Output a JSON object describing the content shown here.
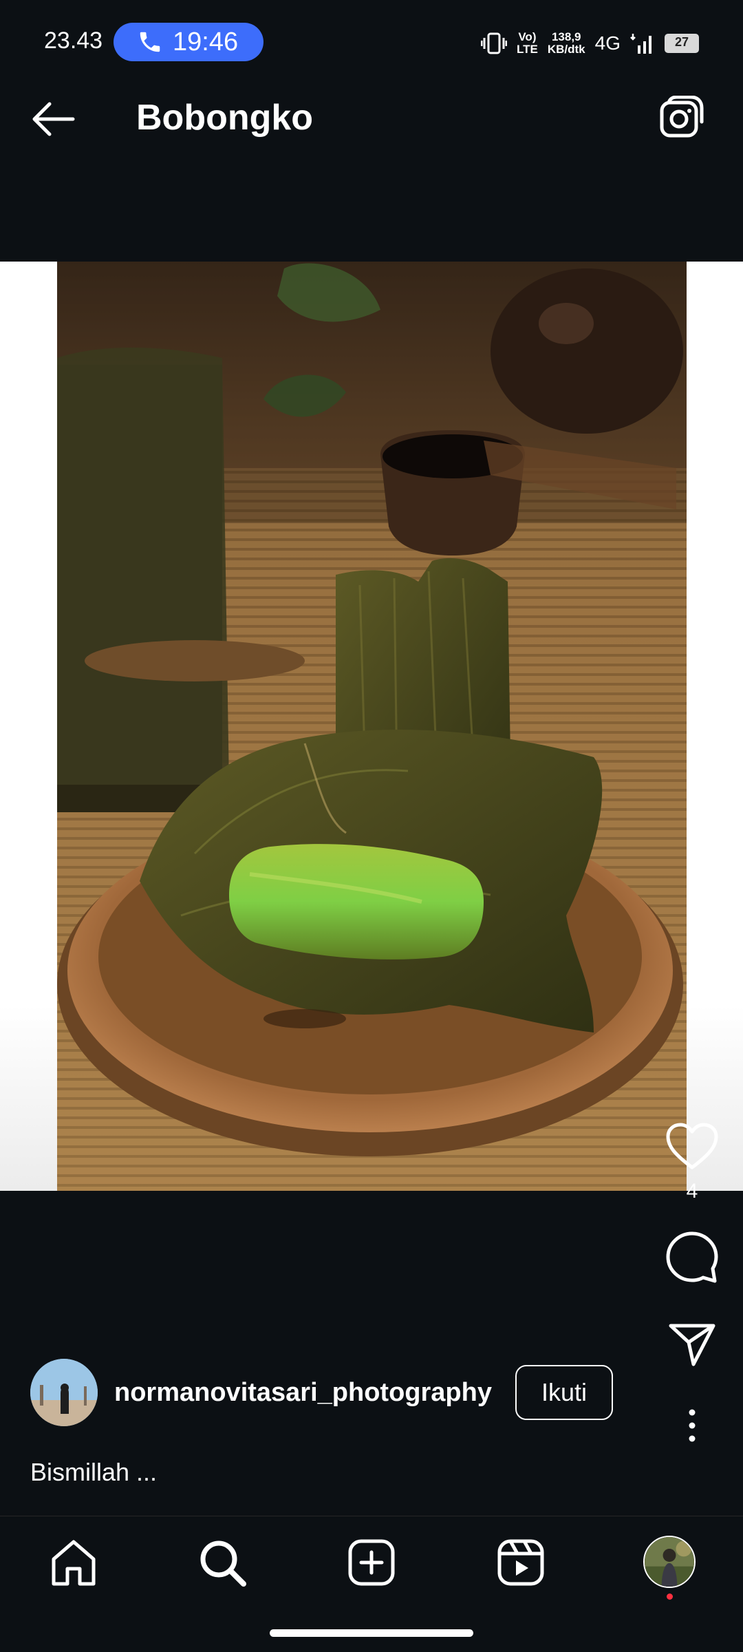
{
  "status_bar": {
    "time": "23.43",
    "call_time": "19:46",
    "network_speed_value": "138,9",
    "network_speed_unit": "KB/dtk",
    "volte_top": "Vo)",
    "volte_bottom": "LTE",
    "network_type": "4G",
    "battery_level": "27"
  },
  "header": {
    "title": "Bobongko"
  },
  "post": {
    "like_count": "4",
    "author": "normanovitasari_photography",
    "follow_label": "Ikuti",
    "caption": "Bismillah ..."
  },
  "icons": {
    "back": "arrow-left-icon",
    "camera": "camera-icon",
    "like": "heart-icon",
    "comment": "comment-bubble-icon",
    "share": "paper-plane-icon",
    "more": "vertical-dots-icon",
    "nav": [
      "home-icon",
      "search-icon",
      "create-plus-icon",
      "reels-icon",
      "profile-avatar"
    ]
  },
  "colors": {
    "background": "#0c1014",
    "call_pill": "#3d6dfb",
    "notification_dot": "#ff3040"
  }
}
